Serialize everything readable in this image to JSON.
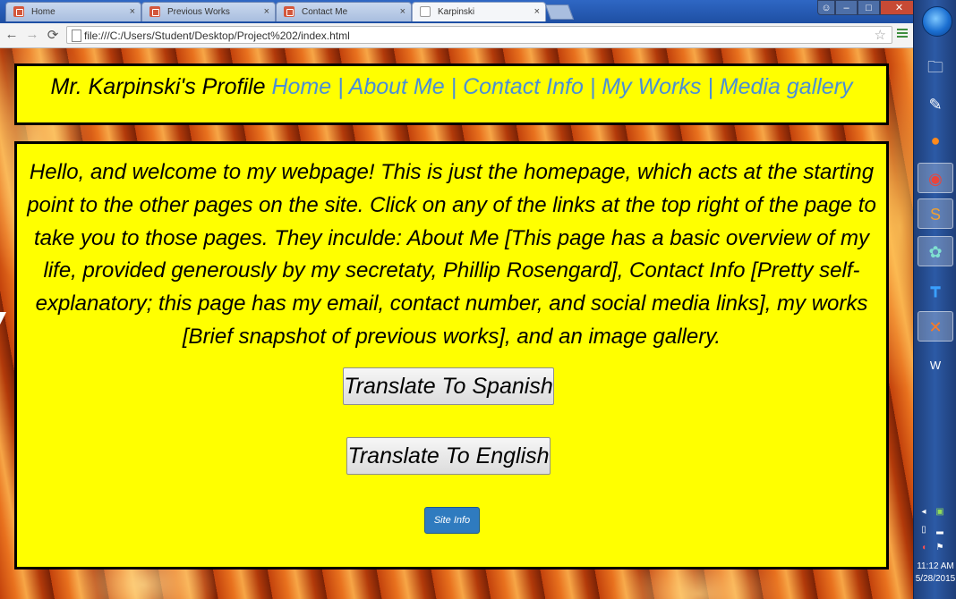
{
  "browser": {
    "tabs": [
      {
        "label": "Home",
        "active": false
      },
      {
        "label": "Previous Works",
        "active": false
      },
      {
        "label": "Contact Me",
        "active": false
      },
      {
        "label": "Karpinski",
        "active": true
      }
    ],
    "tab_close_glyph": "×",
    "url": "file:///C:/Users/Student/Desktop/Project%202/index.html",
    "back_glyph": "←",
    "forward_glyph": "→",
    "reload_glyph": "⟳",
    "star_glyph": "☆"
  },
  "window_controls": {
    "minimize": "–",
    "maximize": "□",
    "close": "✕"
  },
  "page": {
    "header": {
      "title": "Mr. Karpinski's Profile",
      "links": [
        "Home",
        "About Me",
        "Contact Info",
        "My Works",
        "Media gallery"
      ],
      "separator": "|"
    },
    "welcome_text": "Hello, and welcome to my webpage! This is just the homepage, which acts at the starting point to the other pages on the site. Click on any of the links at the top right of the page to take you to those pages. They inculde: About Me [This page has a basic overview of my life, provided generously by my secretaty, Phillip Rosengard], Contact Info [Pretty self-explanatory; this page has my email, contact number, and social media links], my works [Brief snapshot of previous works], and an image gallery.",
    "buttons": {
      "translate_spanish": "Translate To Spanish",
      "translate_english": "Translate To English",
      "site_info": "Site Info"
    }
  },
  "taskbar": {
    "pinned": [
      "folder-icon",
      "paint-icon",
      "firefox-icon",
      "chrome-icon",
      "sublime-icon",
      "app-icon",
      "tetris-icon",
      "xampp-icon",
      "word-icon"
    ],
    "clock_time": "11:12 AM",
    "clock_date": "5/28/2015"
  }
}
